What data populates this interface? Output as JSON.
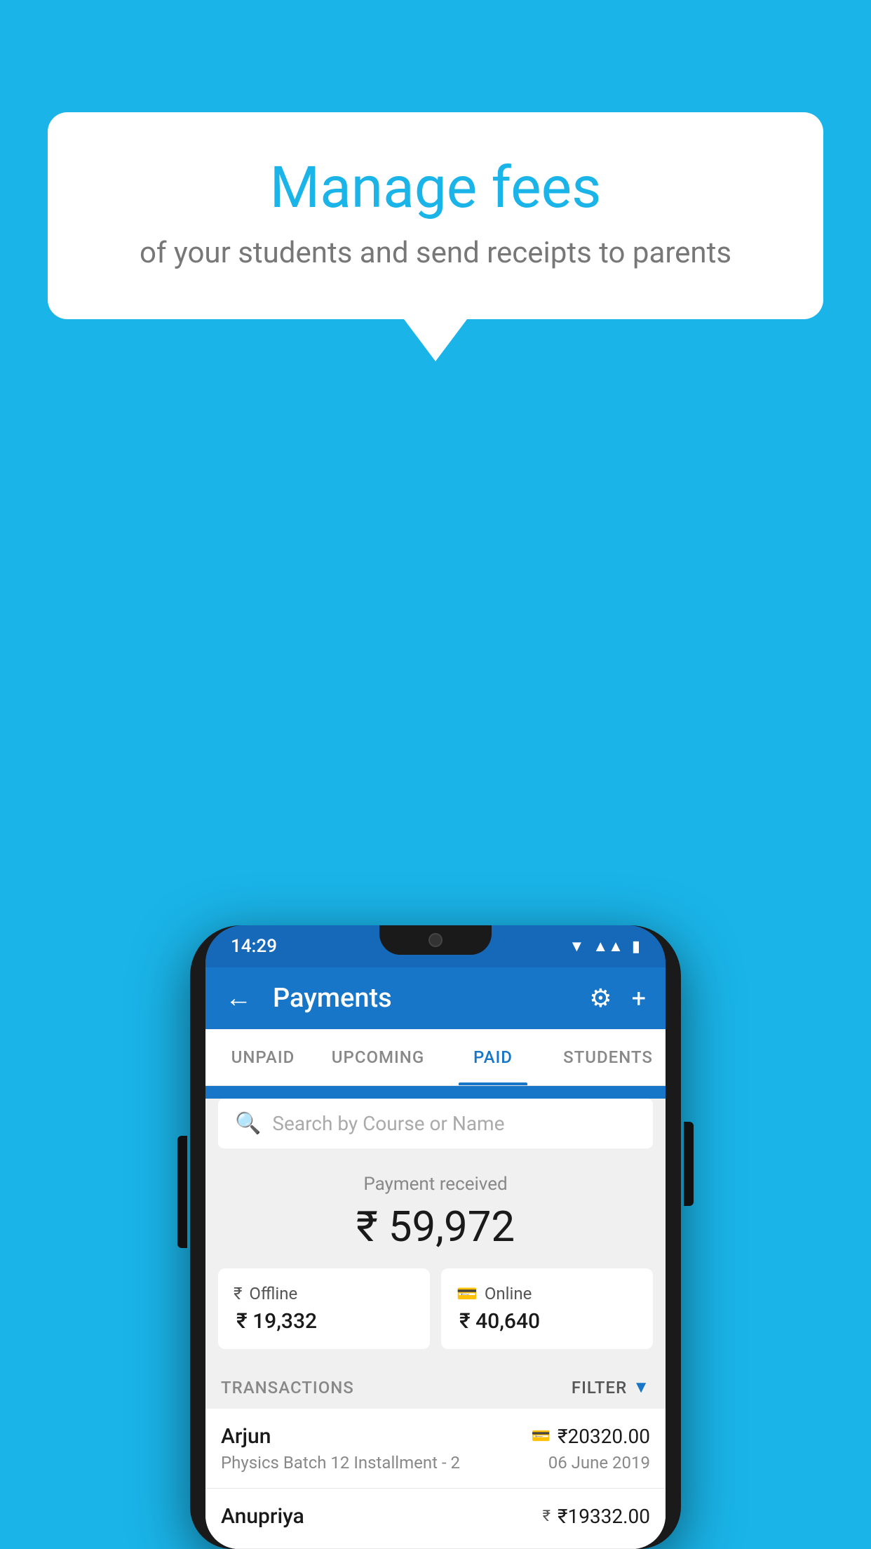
{
  "background_color": "#1ab4e8",
  "bubble": {
    "title": "Manage fees",
    "subtitle": "of your students and send receipts to parents"
  },
  "status_bar": {
    "time": "14:29",
    "icons": [
      "wifi",
      "signal",
      "battery"
    ]
  },
  "app_bar": {
    "title": "Payments",
    "back_label": "←",
    "settings_icon": "⚙",
    "add_icon": "+"
  },
  "tabs": [
    {
      "label": "UNPAID",
      "active": false
    },
    {
      "label": "UPCOMING",
      "active": false
    },
    {
      "label": "PAID",
      "active": true
    },
    {
      "label": "STUDENTS",
      "active": false
    }
  ],
  "search": {
    "placeholder": "Search by Course or Name"
  },
  "payment_summary": {
    "received_label": "Payment received",
    "total_amount": "₹ 59,972",
    "offline": {
      "label": "Offline",
      "amount": "₹ 19,332"
    },
    "online": {
      "label": "Online",
      "amount": "₹ 40,640"
    }
  },
  "transactions": {
    "header_label": "TRANSACTIONS",
    "filter_label": "FILTER",
    "items": [
      {
        "name": "Arjun",
        "course": "Physics Batch 12 Installment - 2",
        "amount": "₹20320.00",
        "date": "06 June 2019",
        "payment_type": "card"
      },
      {
        "name": "Anupriya",
        "course": "",
        "amount": "₹19332.00",
        "date": "",
        "payment_type": "cash"
      }
    ]
  }
}
